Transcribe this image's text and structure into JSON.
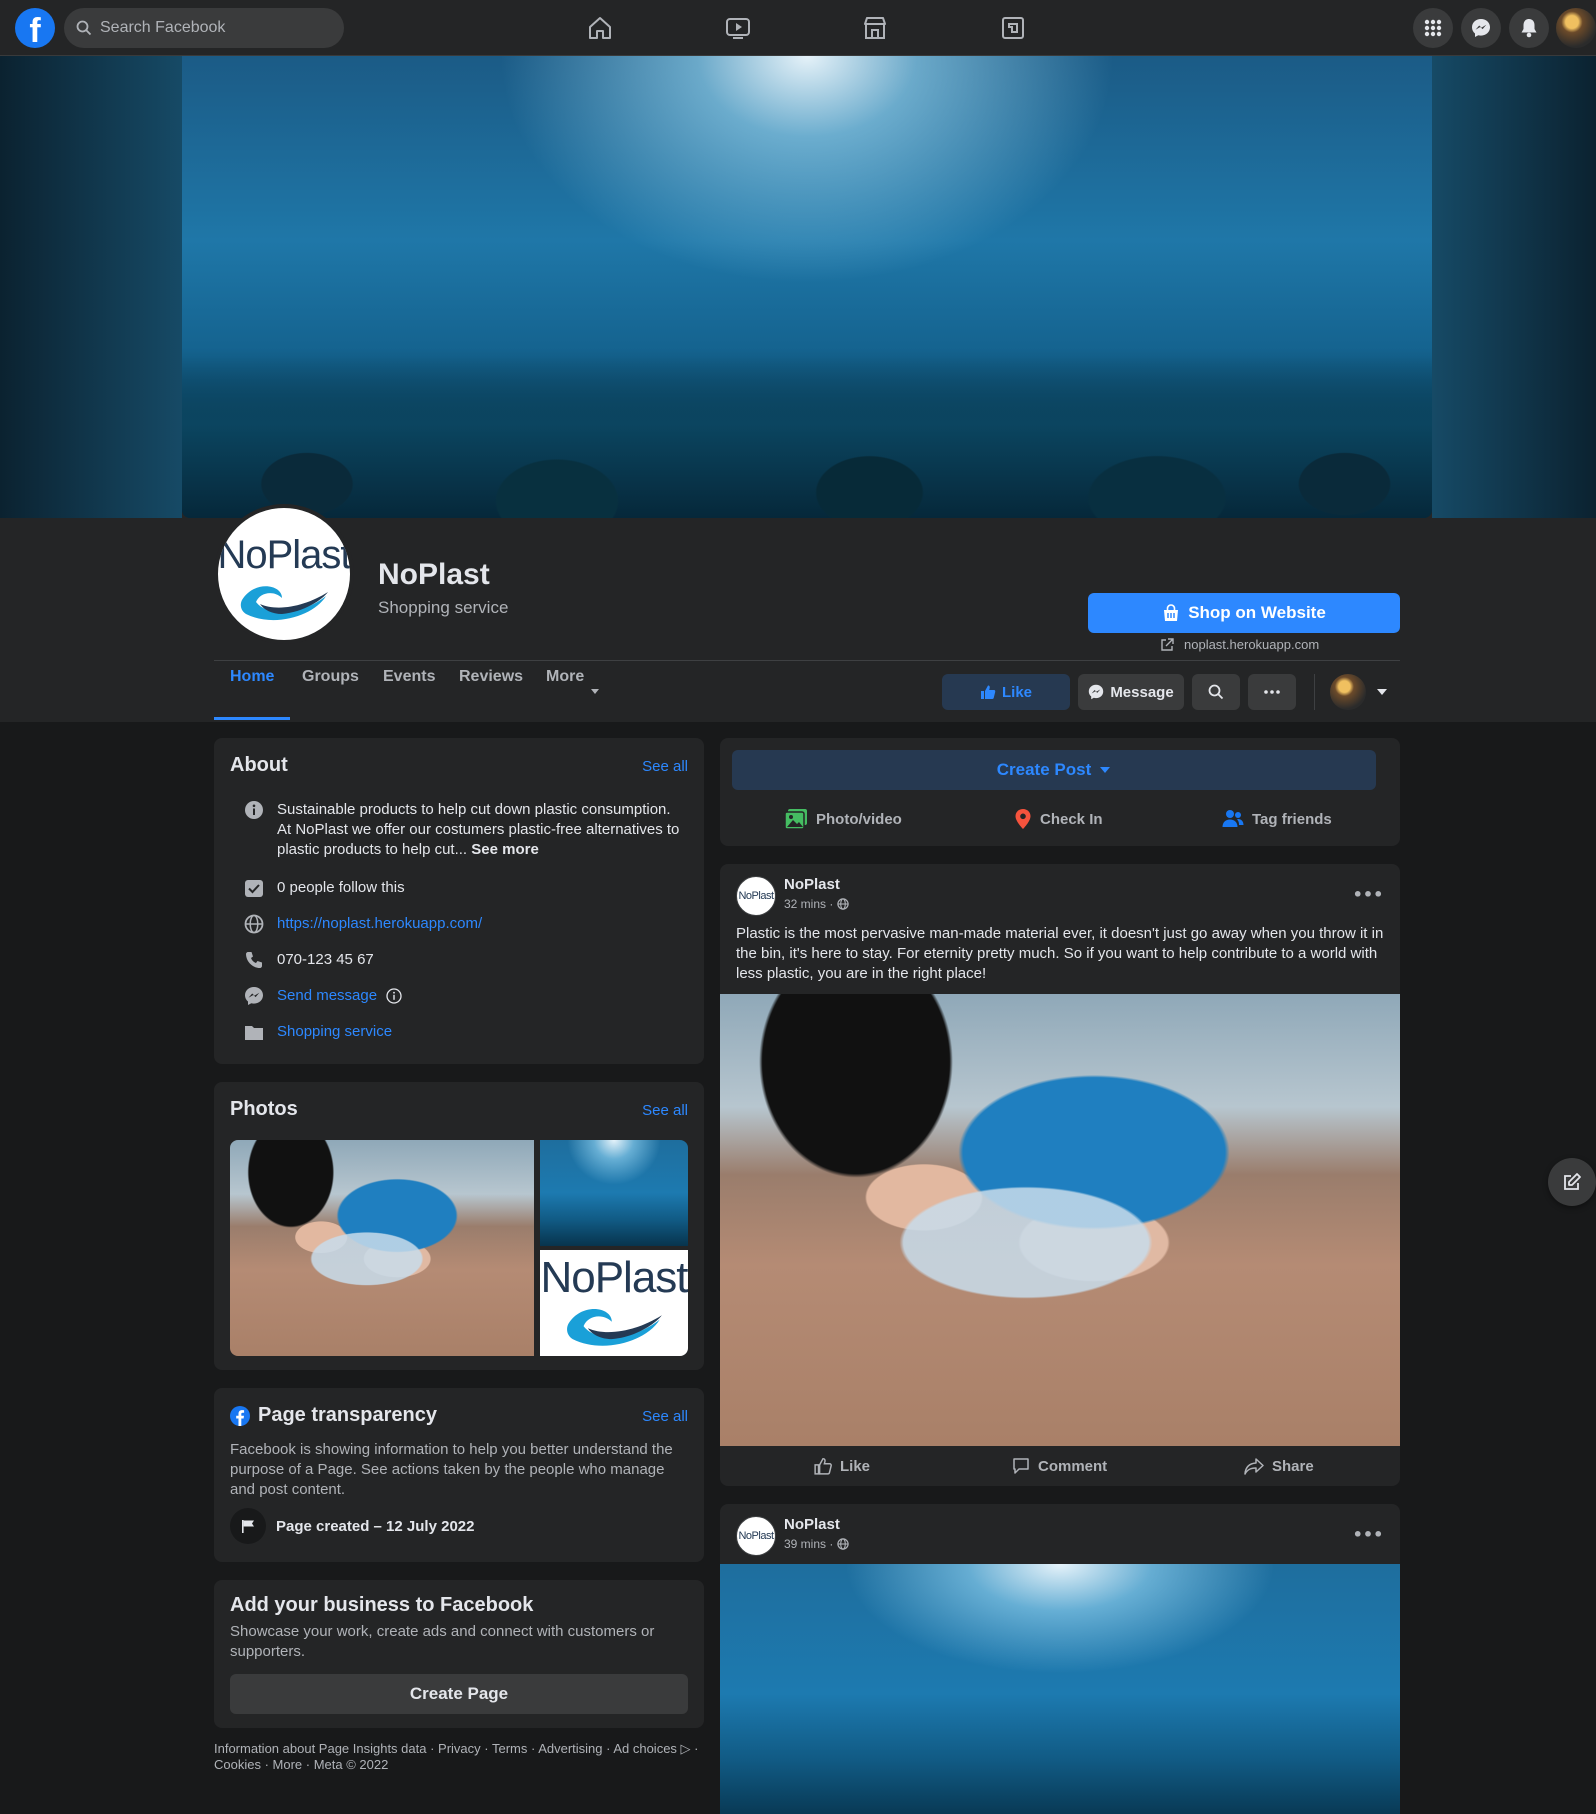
{
  "topbar": {
    "search_placeholder": "Search Facebook",
    "nav_icons": [
      "home-icon",
      "watch-icon",
      "marketplace-icon",
      "gaming-icon"
    ],
    "right_icons": [
      "menu-grid-icon",
      "messenger-icon",
      "notifications-icon"
    ]
  },
  "colors": {
    "accent": "#2d88ff",
    "background": "#18191a",
    "surface": "#242526",
    "button": "#3a3b3c"
  },
  "page": {
    "logo_text": "NoPlast",
    "name": "NoPlast",
    "category": "Shopping service",
    "cta_label": "Shop on Website",
    "cta_link": "noplast.herokuapp.com"
  },
  "tabs": [
    {
      "label": "Home",
      "active": true
    },
    {
      "label": "Groups"
    },
    {
      "label": "Events"
    },
    {
      "label": "Reviews"
    },
    {
      "label": "More"
    }
  ],
  "header_buttons": {
    "like": "Like",
    "message": "Message"
  },
  "about": {
    "title": "About",
    "see_all": "See all",
    "description_1": "Sustainable products to help cut down plastic consumption.",
    "description_2": "At NoPlast we offer our costumers plastic-free alternatives to",
    "description_3": "plastic products to help cut...",
    "see_more": "See more",
    "followers": "0 people follow this",
    "website": "https://noplast.herokuapp.com/",
    "phone": "070-123 45 67",
    "send_message": "Send message",
    "category": "Shopping service"
  },
  "photos": {
    "title": "Photos",
    "see_all": "See all",
    "logo_text": "NoPlast"
  },
  "transparency": {
    "title": "Page transparency",
    "see_all": "See all",
    "text": "Facebook is showing information to help you better understand the purpose of a Page. See actions taken by the people who manage and post content.",
    "created": "Page created – 12 July 2022"
  },
  "business": {
    "title": "Add your business to Facebook",
    "text": "Showcase your work, create ads and connect with customers or supporters.",
    "button": "Create Page"
  },
  "footer": {
    "line1": "Information about Page Insights data · Privacy · Terms · Advertising · Ad choices ▷ ·",
    "line2": "Cookies · More · Meta © 2022"
  },
  "create_post": {
    "button": "Create Post",
    "photo": "Photo/video",
    "checkin": "Check In",
    "tag": "Tag friends"
  },
  "posts": [
    {
      "author": "NoPlast",
      "avatar_text": "NoPlast",
      "time": "32 mins ·",
      "text": "Plastic is the most pervasive man-made material ever, it doesn't just go away when you throw it in the bin, it's here to stay. For eternity pretty much. So if you want to help contribute to a world with less plastic, you are in the right place!",
      "actions": {
        "like": "Like",
        "comment": "Comment",
        "share": "Share"
      }
    },
    {
      "author": "NoPlast",
      "avatar_text": "NoPlast",
      "time": "39 mins ·"
    }
  ]
}
